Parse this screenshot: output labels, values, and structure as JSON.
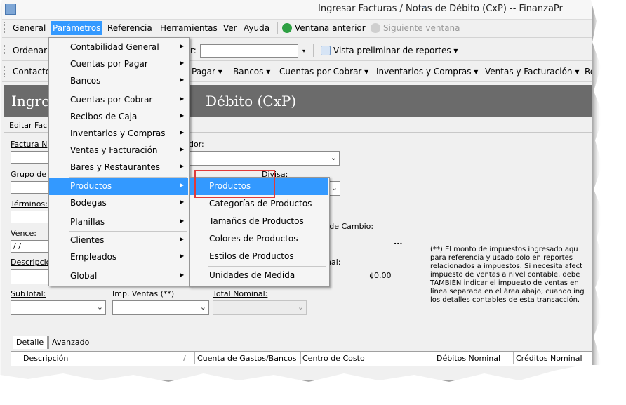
{
  "window": {
    "title": "Ingresar Facturas / Notas de Débito (CxP) -- FinanzaPr"
  },
  "menubar": {
    "items": [
      "General",
      "Parámetros",
      "Referencia",
      "Herramientas",
      "Ver",
      "Ayuda"
    ],
    "back_label": "Ventana anterior",
    "forward_label": "Siguiente ventana"
  },
  "toolbar1": {
    "order_label": "Ordenar:",
    "partial_label": "r:",
    "preview_label": "Vista preliminar de reportes ▾"
  },
  "toolbar2": {
    "items": [
      "Contacto",
      "Pagar ▾",
      "Bancos ▾",
      "Cuentas por Cobrar ▾",
      "Inventarios y Compras ▾",
      "Ventas y Facturación ▾",
      "Re"
    ]
  },
  "header": {
    "title_left": "Ingres",
    "title_right": "Débito (CxP)"
  },
  "subtoolbar": {
    "label": "Editar Fact"
  },
  "form": {
    "factura_label": "Factura N",
    "proveedor_label": "dor:",
    "grupo_label": "Grupo de",
    "divisa_label": "Divisa:",
    "terminos_label": "Términos:",
    "tipo_cambio_label": "o de Cambio:",
    "vence_label": "Vence:",
    "vence_value": " / /",
    "ellipsis": "...",
    "descripcion_label": "Descripció",
    "nal_label": "nal:",
    "amount_value": "¢0.00",
    "subtotal_label": "SubTotal:",
    "imp_label": "Imp. Ventas (**)",
    "total_label": "Total Nominal:"
  },
  "note": "(**) El monto de impuestos ingresado aqu para referencia y usado solo en reportes relacionados a impuestos. Si necesita afect impuesto de ventas a nivel contable, debe TAMBIÉN indicar el impuesto de ventas en línea separada en el área abajo, cuando ing los detalles contables de esta transacción.",
  "tabs": [
    "Detalle",
    "Avanzado"
  ],
  "grid": {
    "columns": [
      "Descripción",
      "/",
      "Cuenta de Gastos/Bancos",
      "Centro de Costo",
      "Débitos Nominal",
      "Créditos Nominal"
    ]
  },
  "menu_parametros": {
    "items": [
      {
        "label": "Contabilidad General",
        "submenu": true
      },
      {
        "label": "Cuentas por Pagar",
        "submenu": true
      },
      {
        "label": "Bancos",
        "submenu": true
      },
      {
        "label": "Cuentas por Cobrar",
        "submenu": true
      },
      {
        "label": "Recibos de Caja",
        "submenu": true
      },
      {
        "label": "Inventarios y Compras",
        "submenu": true
      },
      {
        "label": "Ventas y Facturación",
        "submenu": true
      },
      {
        "label": "Bares y Restaurantes",
        "submenu": true
      },
      {
        "label": "Productos",
        "submenu": true
      },
      {
        "label": "Bodegas",
        "submenu": true
      },
      {
        "label": "Planillas",
        "submenu": true
      },
      {
        "label": "Clientes",
        "submenu": true
      },
      {
        "label": "Empleados",
        "submenu": true
      },
      {
        "label": "Global",
        "submenu": true
      }
    ]
  },
  "menu_productos": {
    "items": [
      "Productos",
      "Categorías de Productos",
      "Tamaños de Productos",
      "Colores de Productos",
      "Estilos de Productos",
      "Unidades de Medida"
    ]
  },
  "colors": {
    "highlight": "#3399ff",
    "header_band": "#6b6b6b",
    "callout": "#e03a3a"
  }
}
